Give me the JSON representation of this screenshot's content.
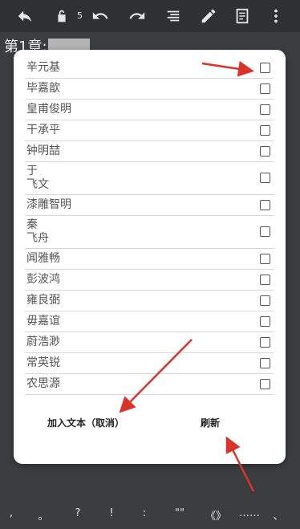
{
  "toolbar": {
    "count": "5",
    "icons": [
      "share-icon",
      "lock-icon",
      "undo-icon",
      "redo-icon",
      "format-list-icon",
      "edit-pencil-icon",
      "preview-icon",
      "more-vert-icon"
    ]
  },
  "chapter": {
    "title": "第1章:"
  },
  "dialog": {
    "items": [
      {
        "label": "辛元基",
        "checked": false
      },
      {
        "label": "毕嘉歆",
        "checked": false
      },
      {
        "label": "皇甫俊明",
        "checked": false
      },
      {
        "label": "干承平",
        "checked": false
      },
      {
        "label": "钟明喆",
        "checked": false
      },
      {
        "label": "于\n飞文",
        "checked": false
      },
      {
        "label": "漆雕智明",
        "checked": false
      },
      {
        "label": "秦\n飞舟",
        "checked": false
      },
      {
        "label": "闻雅畅",
        "checked": false
      },
      {
        "label": "彭波鸿",
        "checked": false
      },
      {
        "label": "雍良弼",
        "checked": false
      },
      {
        "label": "毋嘉谊",
        "checked": false
      },
      {
        "label": "蔚浩渺",
        "checked": false
      },
      {
        "label": "常英锐",
        "checked": false
      },
      {
        "label": "农思源",
        "checked": false
      }
    ],
    "add_button": "加入文本（取消）",
    "refresh_button": "刷新"
  },
  "bottombar": {
    "keys": [
      ",",
      "。",
      "?",
      "!",
      ":",
      "\"\"",
      "《》",
      "……",
      "、"
    ]
  },
  "colors": {
    "annotation_arrow": "#d9342b"
  }
}
